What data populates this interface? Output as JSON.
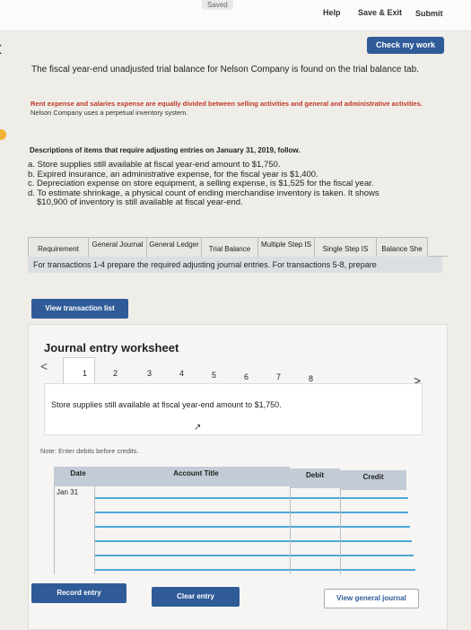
{
  "topbar": {
    "saved": "Saved",
    "help": "Help",
    "save_exit": "Save & Exit",
    "submit": "Submit"
  },
  "check_work": "Check my work",
  "intro": "The fiscal year-end unadjusted trial balance for Nelson Company is found on the trial balance tab.",
  "red_note": "Rent expense and salaries expense are equally divided between selling activities and general and administrative activities.",
  "red_note_cont": " Nelson Company uses a perpetual inventory system.",
  "desc_title": "Descriptions of items that require adjusting entries on January 31, 2019, follow.",
  "items": {
    "a": "a. Store supplies still available at fiscal year-end amount to $1,750.",
    "b": "b. Expired insurance, an administrative expense, for the fiscal year is $1,400.",
    "c": "c. Depreciation expense on store equipment, a selling expense, is $1,525 for the fiscal year.",
    "d1": "d. To estimate shrinkage, a physical count of ending merchandise inventory is taken. It shows",
    "d2": "$10,900 of inventory is still available at fiscal year-end."
  },
  "tabs": [
    "Requirement",
    "General Journal",
    "General Ledger",
    "Trial Balance",
    "Multiple Step IS",
    "Single Step IS",
    "Balance She"
  ],
  "instruction": "For transactions 1-4 prepare the required adjusting journal entries. For transactions 5-8, prepare",
  "view_transaction_list": "View transaction list",
  "worksheet": {
    "title": "Journal entry worksheet",
    "pages": [
      "1",
      "2",
      "3",
      "4",
      "5",
      "6",
      "7",
      "8"
    ],
    "active_page": "1",
    "prev": "<",
    "next": ">",
    "transaction_text": "Store supplies still available at fiscal year-end amount to $1,750.",
    "note": "Note: Enter debits before credits.",
    "columns": {
      "date": "Date",
      "account": "Account Title",
      "debit": "Debit",
      "credit": "Credit"
    },
    "date_value": "Jan 31",
    "record_entry": "Record entry",
    "clear_entry": "Clear entry",
    "view_general_journal": "View general journal"
  },
  "colors": {
    "primary_button": "#2f5c98",
    "warning_text": "#c0392b",
    "row_line": "#4ba8d8"
  },
  "icons": [
    "chevron-left-icon",
    "chevron-right-icon",
    "cursor-icon"
  ]
}
